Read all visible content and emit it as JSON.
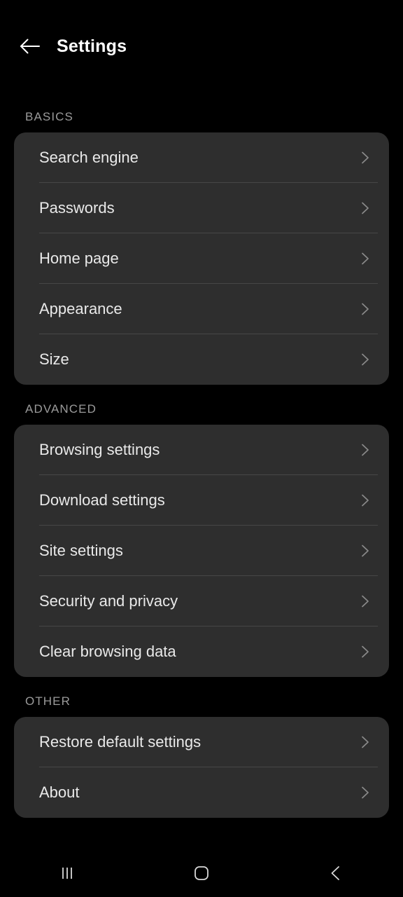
{
  "header": {
    "title": "Settings",
    "back_icon": "arrow-left-icon"
  },
  "sections": [
    {
      "label": "BASICS",
      "items": [
        {
          "label": "Search engine",
          "chevron": "chevron-right-icon"
        },
        {
          "label": "Passwords",
          "chevron": "chevron-right-icon"
        },
        {
          "label": "Home page",
          "chevron": "chevron-right-icon"
        },
        {
          "label": "Appearance",
          "chevron": "chevron-right-icon"
        },
        {
          "label": "Size",
          "chevron": "chevron-right-icon"
        }
      ]
    },
    {
      "label": "ADVANCED",
      "items": [
        {
          "label": "Browsing settings",
          "chevron": "chevron-right-icon"
        },
        {
          "label": "Download settings",
          "chevron": "chevron-right-icon"
        },
        {
          "label": "Site settings",
          "chevron": "chevron-right-icon"
        },
        {
          "label": "Security and privacy",
          "chevron": "chevron-right-icon"
        },
        {
          "label": "Clear browsing data",
          "chevron": "chevron-right-icon"
        }
      ]
    },
    {
      "label": "OTHER",
      "items": [
        {
          "label": "Restore default settings",
          "chevron": "chevron-right-icon"
        },
        {
          "label": "About",
          "chevron": "chevron-right-icon"
        }
      ]
    }
  ],
  "navbar": {
    "recents": "recents-icon",
    "home": "home-icon",
    "back": "back-icon"
  },
  "colors": {
    "page_background": "#000000",
    "card_background": "#2e2e2e",
    "divider": "#474747",
    "primary_text": "#e9e9e9",
    "secondary_text": "#9b9b9b",
    "title_text": "#ffffff",
    "chevron": "#8a8a8a"
  }
}
